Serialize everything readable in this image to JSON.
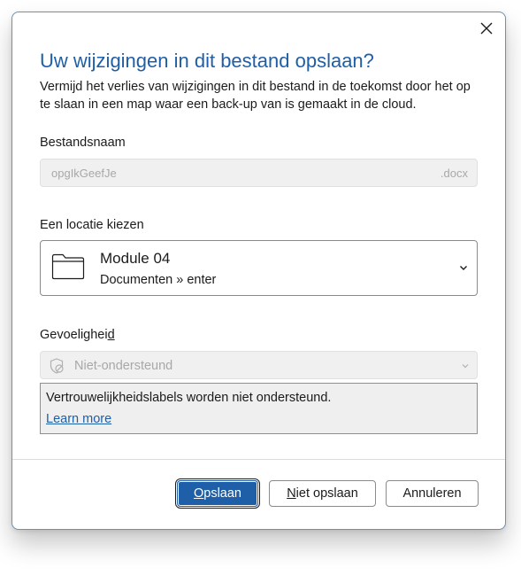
{
  "dialog": {
    "title": "Uw wijzigingen in dit bestand opslaan?",
    "subtitle": "Vermijd het verlies van wijzigingen in dit bestand in de toekomst door het op te slaan in een map waar een back-up van is gemaakt in de cloud.",
    "close_icon": "close-icon"
  },
  "filename": {
    "label": "Bestandsnaam",
    "value": "opgIkGeefJe",
    "extension": ".docx"
  },
  "location": {
    "label": "Een locatie kiezen",
    "folder_name": "Module 04",
    "folder_path": "Documenten » enter",
    "icon": "folder-icon"
  },
  "sensitivity": {
    "label_prefix": "Gevoelighei",
    "label_access_key": "d",
    "value": "Niet-ondersteund",
    "icon": "shield-disabled-icon",
    "info_message": "Vertrouwelijkheidslabels worden niet ondersteund.",
    "learn_more": "Learn more"
  },
  "buttons": {
    "save_access_key": "O",
    "save_rest": "pslaan",
    "dont_save_access_key": "N",
    "dont_save_rest": "iet opslaan",
    "cancel": "Annuleren"
  },
  "colors": {
    "accent": "#1f5fa7",
    "disabled_bg": "#f0f0f0",
    "disabled_text": "#a8a8a8"
  }
}
